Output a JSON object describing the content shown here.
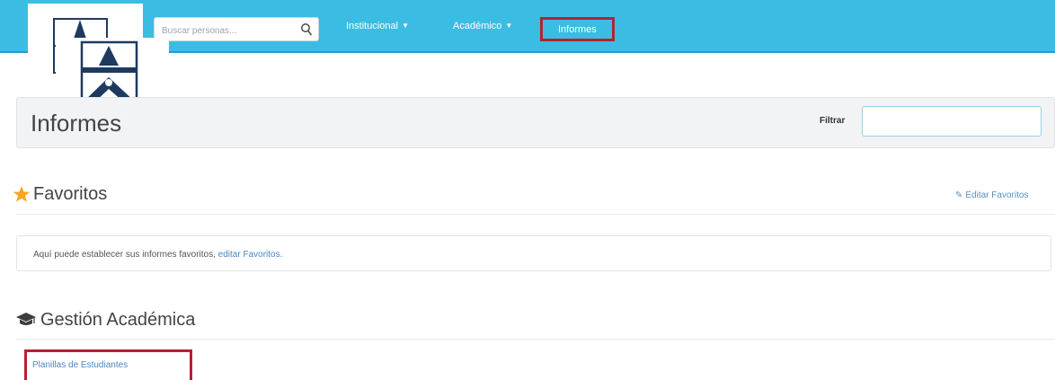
{
  "navbar": {
    "search": {
      "placeholder": "Buscar personas..."
    },
    "items": [
      {
        "label": "Institucional",
        "has_caret": true
      },
      {
        "label": "Académico",
        "has_caret": true
      },
      {
        "label": "Informes",
        "has_caret": false,
        "highlighted": true
      }
    ],
    "caret_glyph": "▼"
  },
  "header": {
    "title": "Informes",
    "filter_label": "Filtrar",
    "filter_value": ""
  },
  "favorites": {
    "title": "Favoritos",
    "edit_link": "Editar Favoritos",
    "message": "Aquí puede establecer sus informes favoritos,",
    "message_link": "editar Favoritos."
  },
  "academic": {
    "title": "Gestión Académica",
    "reports": [
      {
        "label": "Planillas de Estudiantes",
        "highlighted": true
      }
    ]
  },
  "colors": {
    "navbar": "#3bbde3",
    "highlight_border": "#b32232",
    "link": "#4a86c5",
    "star": "#f5a623",
    "logo": "#1e3a5f"
  },
  "icons": [
    "search-icon",
    "chevron-down-icon",
    "star-icon",
    "edit-icon",
    "graduation-cap-icon",
    "logo-icon"
  ]
}
